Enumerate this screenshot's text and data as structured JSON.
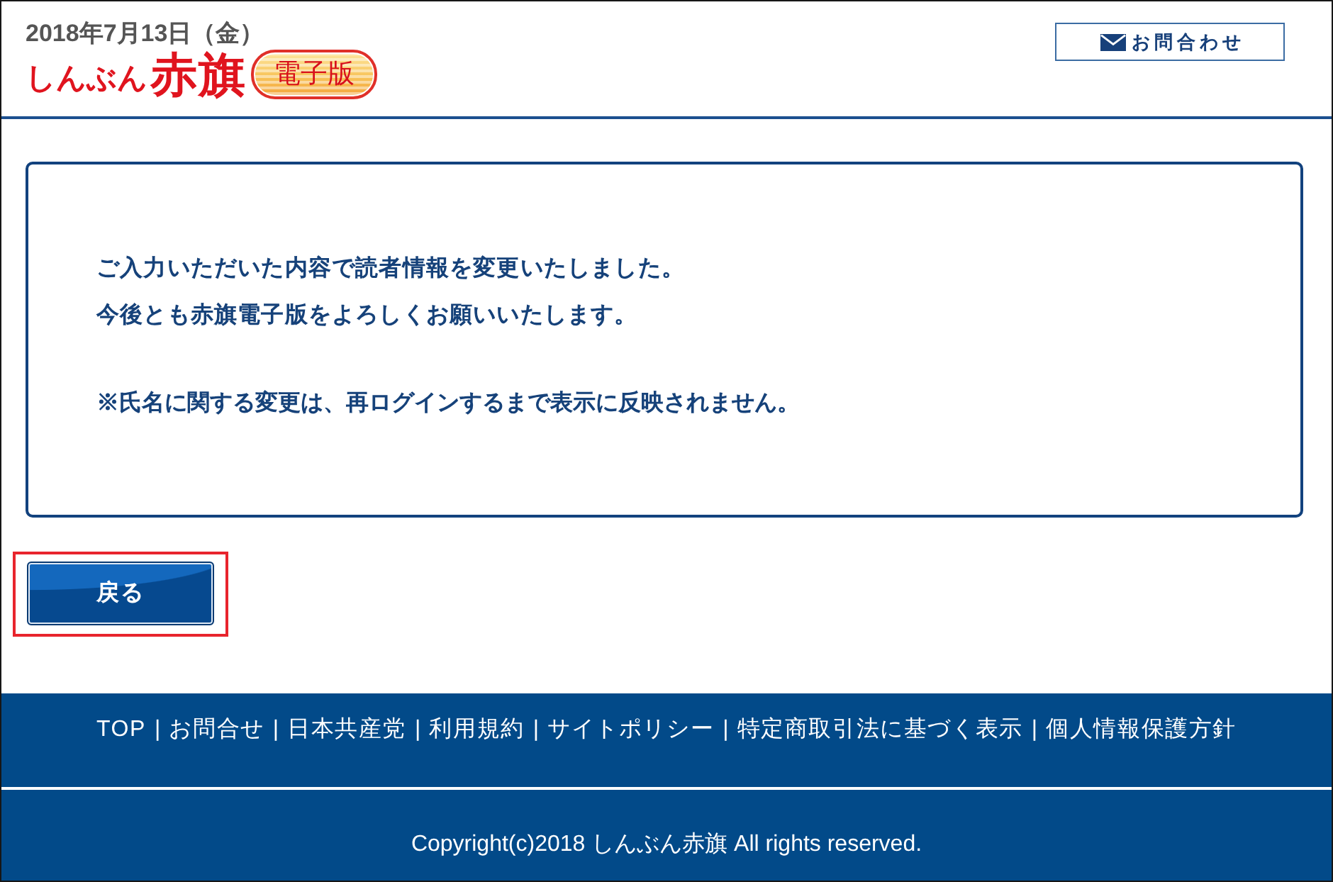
{
  "header": {
    "date": "2018年7月13日（金）",
    "logo": {
      "kana": "しんぶん",
      "title": "赤旗",
      "badge": "電子版"
    },
    "contact_button": {
      "label": "お問合わせ"
    }
  },
  "message": {
    "lines": [
      "ご入力いただいた内容で読者情報を変更いたしました。",
      "今後とも赤旗電子版をよろしくお願いいたします。"
    ],
    "note": "※氏名に関する変更は、再ログインするまで表示に反映されません。"
  },
  "back_button": {
    "label": "戻る",
    "highlighted": true
  },
  "footer": {
    "links": [
      "TOP",
      "お問合せ",
      "日本共産党",
      "利用規約",
      "サイトポリシー",
      "特定商取引法に基づく表示",
      "個人情報保護方針"
    ],
    "separator": "|",
    "copyright": "Copyright(c)2018 しんぶん赤旗 All rights reserved."
  }
}
